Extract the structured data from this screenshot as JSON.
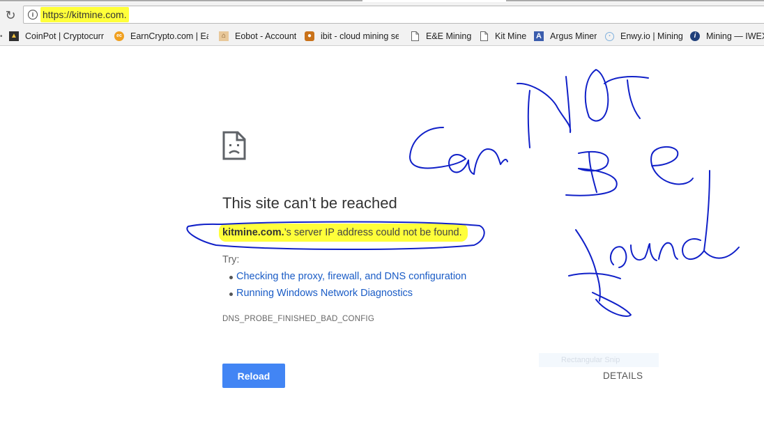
{
  "browser": {
    "url": "https://kitmine.com.",
    "bookmarks": [
      {
        "label": "CoinPot | Cryptocurre",
        "icon": "coinpot-icon",
        "color": "#2f2f2f"
      },
      {
        "label": "EarnCrypto.com | Earn",
        "icon": "earncrypto-icon",
        "color": "#f0a020"
      },
      {
        "label": "Eobot - Account",
        "icon": "eobot-icon",
        "color": "#d9a86b"
      },
      {
        "label": "ibit - cloud mining se",
        "icon": "ibit-icon",
        "color": "#c9721a"
      },
      {
        "label": "E&E Mining",
        "icon": "page-icon",
        "color": "#ffffff"
      },
      {
        "label": "Kit Mine",
        "icon": "page-icon",
        "color": "#ffffff"
      },
      {
        "label": "Argus Miner",
        "icon": "argus-icon",
        "color": "#3b5dad"
      },
      {
        "label": "Enwy.io | Mining",
        "icon": "enwy-icon",
        "color": "#7fb0dd"
      },
      {
        "label": "Mining — IWEX",
        "icon": "iwex-icon",
        "color": "#1f3f7a"
      }
    ]
  },
  "error": {
    "title": "This site can’t be reached",
    "host": "kitmine.com.",
    "message": "’s server IP address could not be found.",
    "try_label": "Try:",
    "suggestions": [
      "Checking the proxy, firewall, and DNS configuration",
      "Running Windows Network Diagnostics"
    ],
    "code": "DNS_PROBE_FINISHED_BAD_CONFIG",
    "reload_label": "Reload",
    "details_label": "DETAILS"
  },
  "overlay": {
    "snip_label": "Rectangular Snip",
    "highlight_color": "#ffff3a",
    "ink_color": "#1020c8"
  }
}
